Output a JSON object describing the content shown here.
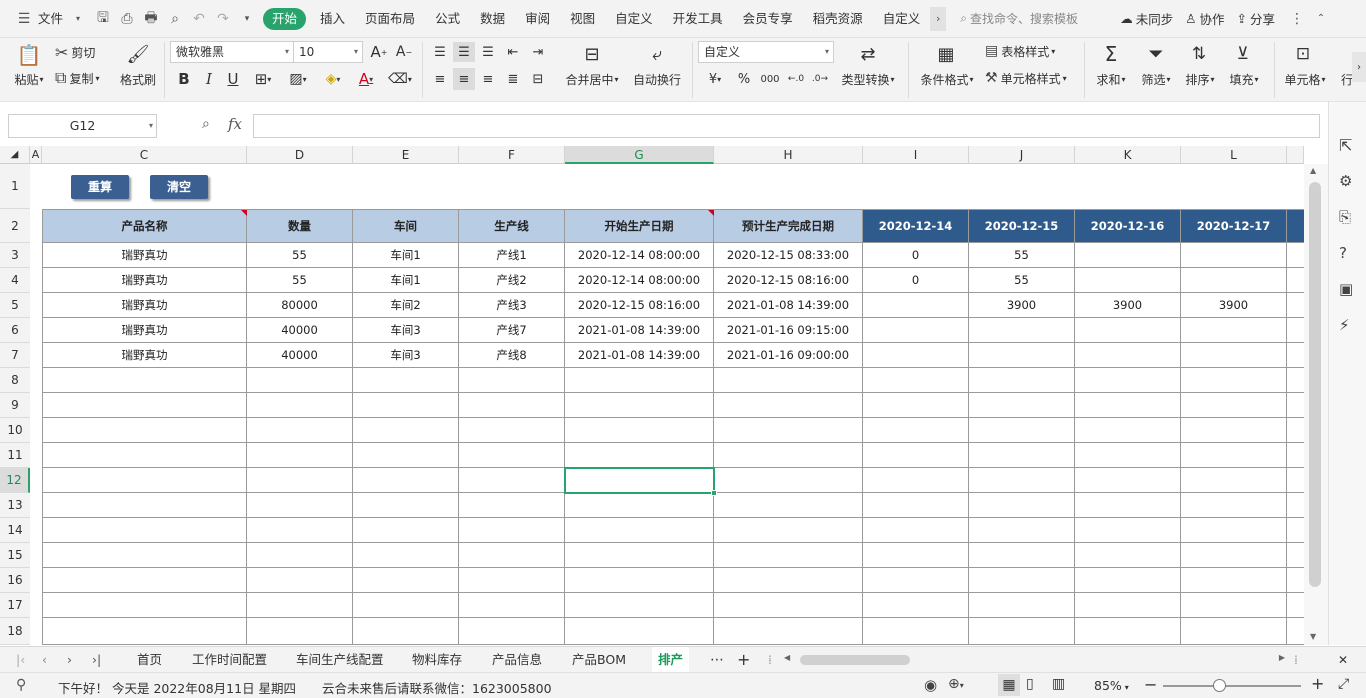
{
  "menubar": {
    "file_label": "文件",
    "tabs": [
      "开始",
      "插入",
      "页面布局",
      "公式",
      "数据",
      "审阅",
      "视图",
      "自定义",
      "开发工具",
      "会员专享",
      "稻壳资源",
      "自定义"
    ],
    "search_placeholder": "查找命令、搜索模板",
    "sync_label": "未同步",
    "collab_label": "协作",
    "share_label": "分享"
  },
  "ribbon": {
    "paste": "粘贴",
    "cut": "剪切",
    "copy": "复制",
    "format_painter": "格式刷",
    "font_name": "微软雅黑",
    "font_size": "10",
    "merge_center": "合并居中",
    "wrap_text": "自动换行",
    "number_format": "自定义",
    "type_convert": "类型转换",
    "cond_format": "条件格式",
    "table_style": "表格样式",
    "cell_style": "单元格样式",
    "sum": "求和",
    "filter": "筛选",
    "sort": "排序",
    "fill": "填充",
    "cell": "单元格",
    "row": "行"
  },
  "formula": {
    "name_box": "G12",
    "fx": "fx",
    "value": ""
  },
  "columns": [
    "A",
    "C",
    "D",
    "E",
    "F",
    "G",
    "H",
    "I",
    "J",
    "K",
    "L"
  ],
  "rows": [
    "1",
    "2",
    "3",
    "4",
    "5",
    "6",
    "7",
    "8",
    "9",
    "10",
    "11",
    "12",
    "13",
    "14",
    "15",
    "16",
    "17",
    "18"
  ],
  "buttons": {
    "recalc": "重算",
    "clear": "清空"
  },
  "table": {
    "headers": [
      "产品名称",
      "数量",
      "车间",
      "生产线",
      "开始生产日期",
      "预计生产完成日期",
      "2020-12-14",
      "2020-12-15",
      "2020-12-16",
      "2020-12-17"
    ],
    "rows": [
      [
        "瑞野真功",
        "55",
        "车间1",
        "产线1",
        "2020-12-14 08:00:00",
        "2020-12-15 08:33:00",
        "0",
        "55",
        "",
        ""
      ],
      [
        "瑞野真功",
        "55",
        "车间1",
        "产线2",
        "2020-12-14 08:00:00",
        "2020-12-15 08:16:00",
        "0",
        "55",
        "",
        ""
      ],
      [
        "瑞野真功",
        "80000",
        "车间2",
        "产线3",
        "2020-12-15 08:16:00",
        "2021-01-08 14:39:00",
        "",
        "3900",
        "3900",
        "3900"
      ],
      [
        "瑞野真功",
        "40000",
        "车间3",
        "产线7",
        "2021-01-08 14:39:00",
        "2021-01-16 09:15:00",
        "",
        "",
        "",
        ""
      ],
      [
        "瑞野真功",
        "40000",
        "车间3",
        "产线8",
        "2021-01-08 14:39:00",
        "2021-01-16 09:00:00",
        "",
        "",
        "",
        ""
      ]
    ]
  },
  "sheets": [
    "首页",
    "工作时间配置",
    "车间生产线配置",
    "物料库存",
    "产品信息",
    "产品BOM",
    "排产"
  ],
  "active_sheet": "排产",
  "status": {
    "greeting": "下午好！ 今天是 2022年08月11日 星期四",
    "message": "云合未来售后请联系微信：1623005800",
    "zoom": "85%"
  },
  "colors": {
    "accent": "#27a36b",
    "header_light": "#b8cce4",
    "header_dark": "#2e5a8c"
  }
}
